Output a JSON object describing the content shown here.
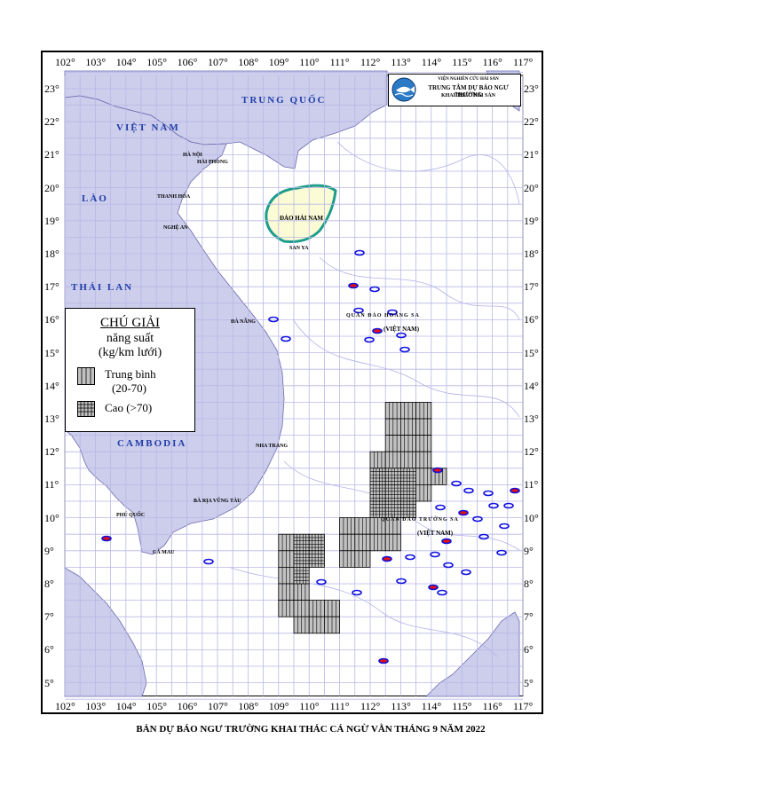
{
  "map": {
    "longitudes": [
      "102°",
      "103°",
      "104°",
      "105°",
      "106°",
      "107°",
      "108°",
      "109°",
      "110°",
      "111°",
      "112°",
      "113°",
      "114°",
      "115°",
      "116°",
      "117°"
    ],
    "latitudes": [
      "23°",
      "22°",
      "21°",
      "20°",
      "19°",
      "18°",
      "17°",
      "16°",
      "15°",
      "14°",
      "13°",
      "12°",
      "11°",
      "10°",
      "9°",
      "8°",
      "7°",
      "6°",
      "5°"
    ],
    "colors": {
      "land": "#cdcdec",
      "sea": "#ffffff",
      "grid": "#b8b8e6",
      "island": "#fbfbd5",
      "coast_island": "#1e9c8c",
      "cell": "#c2c2c2",
      "spot_blue": "#1010e0",
      "spot_red": "#e01010"
    }
  },
  "labels": {
    "countries": {
      "china": "TRUNG QUỐC",
      "vietnam": "VIỆT NAM",
      "laos": "LÀO",
      "thailand": "THÁI LAN",
      "cambodia": "CAMBODIA"
    },
    "places": {
      "ha_noi": "HÀ NỘI",
      "hai_phong": "HẢI PHÒNG",
      "thanh_hoa": "THANH HÓA",
      "nghe_an": "NGHỆ AN",
      "da_nang": "ĐÀ NẴNG",
      "nha_trang": "NHA TRANG",
      "ba_ria": "BÀ RỊA VŨNG TÀU",
      "ca_mau": "CÀ MAU",
      "phu_quoc": "PHÚ QUỐC",
      "dao_hai_nam": "ĐẢO HẢI NAM",
      "san_ya": "SAN YA"
    },
    "archipelagos": {
      "hoang_sa": "QUẦN ĐẢO HOÀNG SA",
      "hoang_sa_vn": "(VIỆT NAM)",
      "truong_sa": "QUẦN ĐẢO TRƯỜNG SA",
      "truong_sa_vn": "(VIỆT NAM)"
    }
  },
  "legend": {
    "title": "CHÚ GIẢI",
    "line1": "năng suất",
    "line2": "(kg/km lưới)",
    "items": [
      {
        "label_line1": "Trung bình",
        "label_line2": "(20-70)",
        "pattern": "medium"
      },
      {
        "label": "Cao (>70)",
        "pattern": "high"
      }
    ]
  },
  "logo": {
    "icon": "fish-logo-icon",
    "line1": "VIỆN NGHIÊN CỨU HẢI SẢN",
    "line2": "TRUNG TÂM DỰ BÁO NGƯ TRƯỜNG",
    "line3": "KHAI THÁC HẢI SẢN"
  },
  "forecast": {
    "medium_cells": [
      {
        "lon": 112.5,
        "lat": 13.0
      },
      {
        "lon": 113.0,
        "lat": 13.0
      },
      {
        "lon": 113.5,
        "lat": 13.0
      },
      {
        "lon": 112.5,
        "lat": 12.5
      },
      {
        "lon": 113.0,
        "lat": 12.5
      },
      {
        "lon": 113.5,
        "lat": 12.5
      },
      {
        "lon": 112.5,
        "lat": 12.0
      },
      {
        "lon": 113.0,
        "lat": 12.0
      },
      {
        "lon": 113.5,
        "lat": 12.0
      },
      {
        "lon": 112.0,
        "lat": 11.5
      },
      {
        "lon": 112.5,
        "lat": 11.5
      },
      {
        "lon": 113.0,
        "lat": 11.5
      },
      {
        "lon": 113.5,
        "lat": 11.5
      },
      {
        "lon": 113.5,
        "lat": 11.0
      },
      {
        "lon": 114.0,
        "lat": 11.0
      },
      {
        "lon": 113.5,
        "lat": 10.5
      },
      {
        "lon": 111.0,
        "lat": 9.5
      },
      {
        "lon": 111.5,
        "lat": 9.5
      },
      {
        "lon": 112.0,
        "lat": 9.5
      },
      {
        "lon": 112.5,
        "lat": 9.5
      },
      {
        "lon": 111.0,
        "lat": 9.0
      },
      {
        "lon": 111.5,
        "lat": 9.0
      },
      {
        "lon": 112.0,
        "lat": 9.0
      },
      {
        "lon": 112.5,
        "lat": 9.0
      },
      {
        "lon": 111.0,
        "lat": 8.5
      },
      {
        "lon": 111.5,
        "lat": 8.5
      },
      {
        "lon": 109.0,
        "lat": 9.0
      },
      {
        "lon": 109.0,
        "lat": 8.5
      },
      {
        "lon": 109.0,
        "lat": 8.0
      },
      {
        "lon": 109.0,
        "lat": 7.5
      },
      {
        "lon": 109.0,
        "lat": 7.0
      },
      {
        "lon": 109.5,
        "lat": 7.5
      },
      {
        "lon": 109.5,
        "lat": 7.0
      },
      {
        "lon": 109.5,
        "lat": 6.5
      },
      {
        "lon": 110.0,
        "lat": 7.0
      },
      {
        "lon": 110.0,
        "lat": 6.5
      },
      {
        "lon": 110.5,
        "lat": 7.0
      },
      {
        "lon": 110.5,
        "lat": 6.5
      }
    ],
    "high_cells": [
      {
        "lon": 112.0,
        "lat": 11.0
      },
      {
        "lon": 112.5,
        "lat": 11.0
      },
      {
        "lon": 113.0,
        "lat": 11.0
      },
      {
        "lon": 112.0,
        "lat": 10.5
      },
      {
        "lon": 112.5,
        "lat": 10.5
      },
      {
        "lon": 113.0,
        "lat": 10.5
      },
      {
        "lon": 112.0,
        "lat": 10.0
      },
      {
        "lon": 112.5,
        "lat": 10.0
      },
      {
        "lon": 113.0,
        "lat": 10.0
      },
      {
        "lon": 109.5,
        "lat": 9.0
      },
      {
        "lon": 110.0,
        "lat": 9.0
      },
      {
        "lon": 109.5,
        "lat": 8.5
      },
      {
        "lon": 110.0,
        "lat": 8.5
      },
      {
        "lon": 109.5,
        "lat": 8.0
      }
    ]
  },
  "caption": "BẢN DỰ BÁO NGƯ TRƯỜNG KHAI THÁC CÁ NGỪ VẰN THÁNG 9 NĂM 2022"
}
